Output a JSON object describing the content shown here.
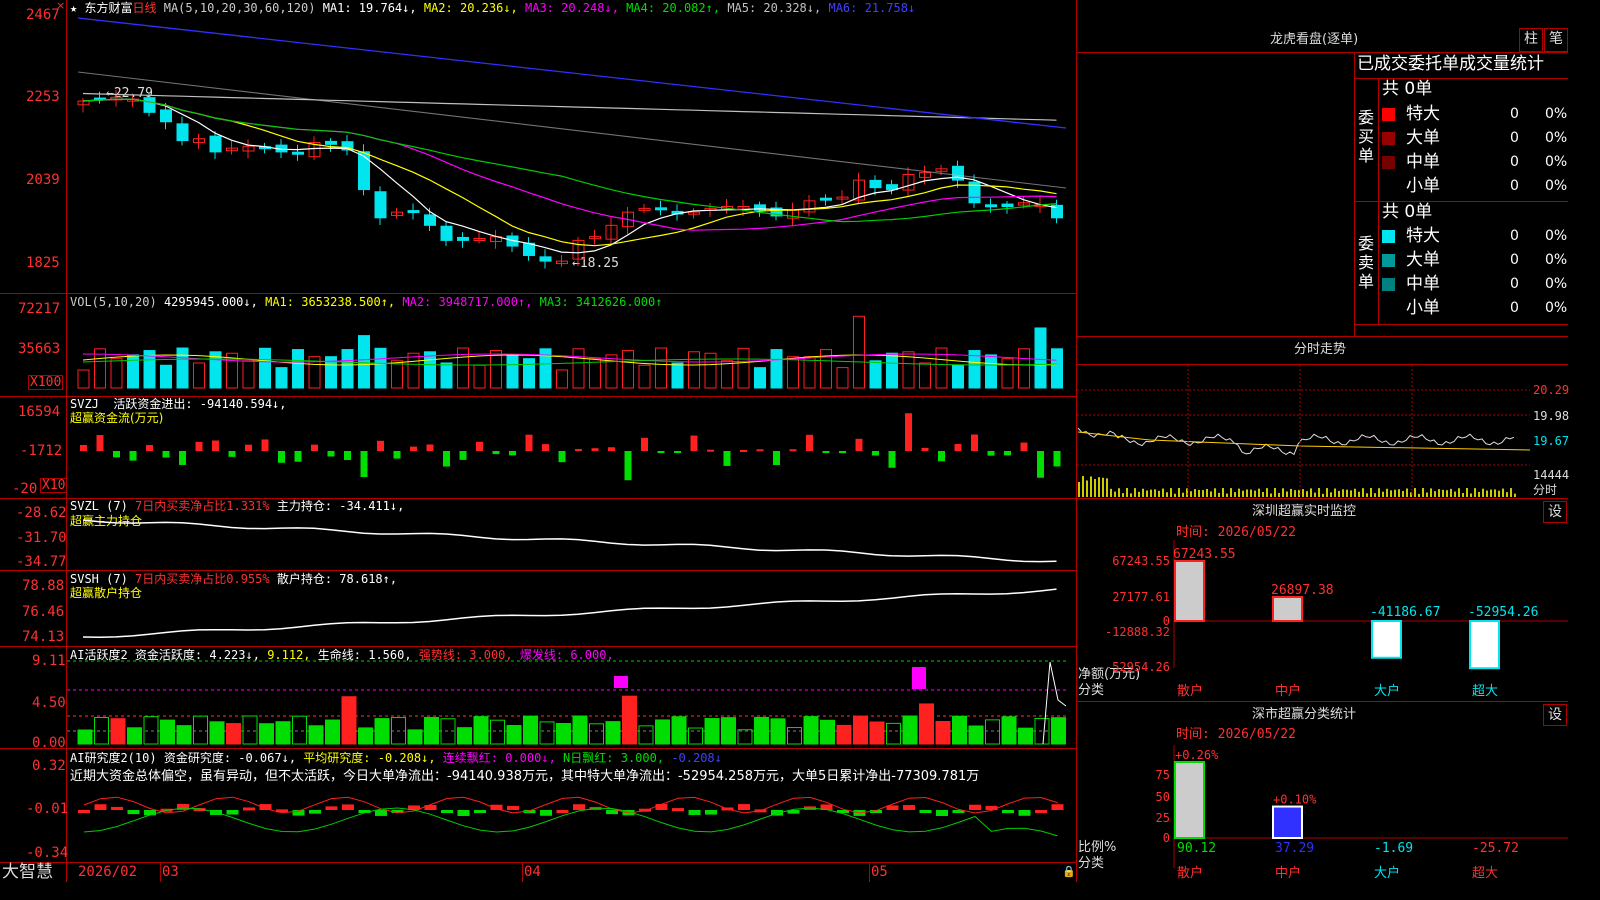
{
  "colors": {
    "up": "#ff2020",
    "down": "#00e5ee",
    "green": "#00dd00",
    "frame": "#b00000",
    "ma1": "#ffffff",
    "ma2": "#ffff00",
    "ma3": "#ff00ff",
    "ma4": "#00cc00",
    "ma5": "#c0c0c0",
    "ma6": "#3030ff"
  },
  "header": {
    "star": "★",
    "stock_name": "东方财富",
    "period": "日线",
    "ma_label": "MA(5,10,20,30,60,120)",
    "ma1": "MA1: 19.764↓,",
    "ma2": "MA2: 20.236↓,",
    "ma3": "MA3: 20.248↓,",
    "ma4": "MA4: 20.082↑,",
    "ma5": "MA5: 20.328↓,",
    "ma6": "MA6: 21.758↓"
  },
  "main_axis": [
    "2467",
    "2253",
    "2039",
    "1825"
  ],
  "main_annotations": {
    "high": "←22.79",
    "low": "←18.25"
  },
  "vol": {
    "label": "VOL(5,10,20)",
    "value": "4295945.000↓,",
    "ma1": "MA1: 3653238.500↑,",
    "ma2": "MA2: 3948717.000↑,",
    "ma3": "MA3: 3412626.000↑",
    "axis": [
      "72217",
      "35663"
    ],
    "unit": "X100"
  },
  "svzj": {
    "label": "SVZJ",
    "desc": "活跃资金进出: -94140.594↓,",
    "sub": "超赢资金流(万元)",
    "axis": [
      "16594",
      "-1712",
      "-20"
    ],
    "unit": "X10"
  },
  "svzl": {
    "label": "SVZL (7)",
    "desc1": "7日内买卖净占比1.331%",
    "desc2": "主力持仓: -34.411↓,",
    "sub": "超赢主力持仓",
    "axis": [
      "-28.62",
      "-31.70",
      "-34.77"
    ]
  },
  "svsh": {
    "label": "SVSH (7)",
    "desc1": "7日内买卖净占比0.955%",
    "desc2": "散户持仓: 78.618↑,",
    "sub": "超赢散户持仓",
    "axis": [
      "78.88",
      "76.46",
      "74.13"
    ]
  },
  "ai1": {
    "label": "AI活跃度2",
    "desc1": "资金活跃度: 4.223↓,",
    "desc2": "9.112,",
    "desc3": "生命线: 1.560,",
    "desc4": "强势线: 3.000,",
    "desc5": "爆发线: 6.000,",
    "axis": [
      "9.11",
      "4.50",
      "0.00"
    ]
  },
  "ai2": {
    "label": "AI研究度2(10)",
    "desc1": "资金研究度: -0.067↓,",
    "desc2": "平均研究度: -0.208↓,",
    "desc3": "连续飘红: 0.000↓,",
    "desc4": "N日飘红: 3.000,",
    "desc5": "-0.208↓",
    "comment": "近期大资金总体偏空，虽有异动，但不太活跃，今日大单净流出：-94140.938万元，其中特大单净流出：-52954.258万元，大单5日累计净出-77309.781万",
    "axis": [
      "0.32",
      "-0.01",
      "-0.34"
    ]
  },
  "footer": {
    "brand": "大智慧",
    "dates": [
      "2026/02",
      "03",
      "04",
      "05"
    ]
  },
  "right": {
    "lh_title": "龙虎看盘(逐单)",
    "btn_zhu": "柱",
    "btn_bi": "笔",
    "stats_title": "已成交委托单成交量统计",
    "buy_total": "共 0单",
    "buy_side": "委买单",
    "buy_rows": [
      {
        "name": "特大",
        "v": "0",
        "p": "0%",
        "color": "#ff0000"
      },
      {
        "name": "大单",
        "v": "0",
        "p": "0%",
        "color": "#990000"
      },
      {
        "name": "中单",
        "v": "0",
        "p": "0%",
        "color": "#770000"
      },
      {
        "name": "小单",
        "v": "0",
        "p": "0%",
        "color": ""
      }
    ],
    "sell_total": "共 0单",
    "sell_side": "委卖单",
    "sell_rows": [
      {
        "name": "特大",
        "v": "0",
        "p": "0%",
        "color": "#00e5ee"
      },
      {
        "name": "大单",
        "v": "0",
        "p": "0%",
        "color": "#009a9a"
      },
      {
        "name": "中单",
        "v": "0",
        "p": "0%",
        "color": "#008080"
      },
      {
        "name": "小单",
        "v": "0",
        "p": "0%",
        "color": ""
      }
    ],
    "fenshi": {
      "title": "分时走势",
      "axis": [
        "20.29",
        "19.98",
        "19.67",
        "14444"
      ],
      "unit": "分时"
    },
    "sz_monitor": {
      "title": "深圳超赢实时监控",
      "settings": "设",
      "time": "时间: 2026/05/22",
      "axis": [
        "67243.55",
        "27177.61",
        "0",
        "-12888.32",
        "-52954.26"
      ],
      "ylabel": "净额(万元)",
      "xlabel": "分类",
      "cats": [
        "散户",
        "中户",
        "大户",
        "超大"
      ],
      "values": [
        67243.55,
        26897.38,
        -41186.67,
        -52954.26
      ],
      "labels": [
        "67243.55",
        "26897.38",
        "-41186.67",
        "-52954.26"
      ]
    },
    "sz_class": {
      "title": "深市超赢分类统计",
      "settings": "设",
      "time": "时间: 2026/05/22",
      "axis": [
        "75",
        "50",
        "25",
        "0"
      ],
      "ylabel": "比例%",
      "xlabel": "分类",
      "cats": [
        "散户",
        "中户",
        "大户",
        "超大"
      ],
      "top": [
        "+0.26%",
        "+0.10%"
      ],
      "bottom": [
        "90.12",
        "37.29",
        "-1.69",
        "-25.72"
      ],
      "values": [
        90.12,
        37.29,
        -1.69,
        -25.72
      ]
    }
  }
}
